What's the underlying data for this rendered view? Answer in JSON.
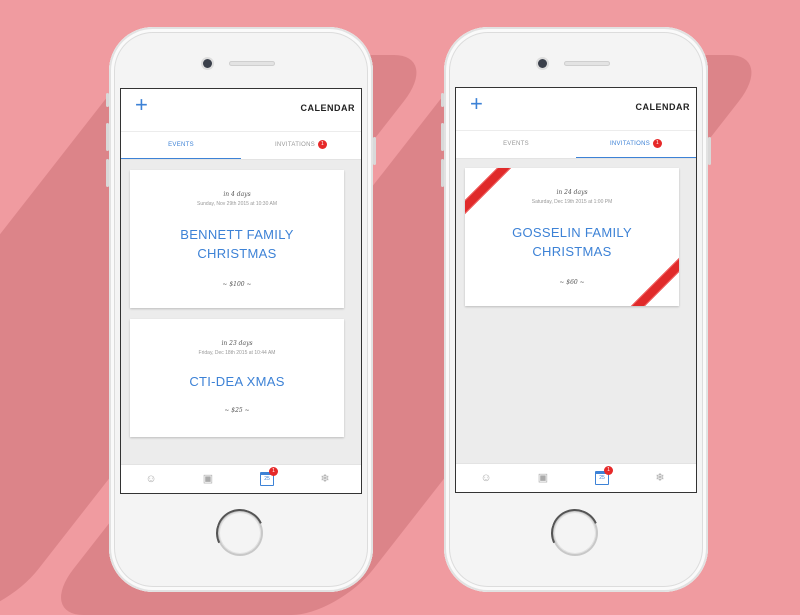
{
  "colors": {
    "background": "#f09ba0",
    "accent": "#3d82d6",
    "badge": "#e62929",
    "ribbon": "#e02a2a"
  },
  "phones": [
    {
      "header": {
        "add_icon": "plus-icon",
        "title": "CALENDAR"
      },
      "tabs": [
        {
          "label": "EVENTS",
          "active": true,
          "badge": ""
        },
        {
          "label": "INVITATIONS",
          "active": false,
          "badge": "1"
        }
      ],
      "cards": [
        {
          "when": "in 4 days",
          "date": "Sunday, Nov 29th 2015 at 10:30 AM",
          "name": "BENNETT FAMILY CHRISTMAS",
          "price": "~ $100 ~"
        },
        {
          "when": "in 23 days",
          "date": "Friday, Dec 18th 2015 at 10:44 AM",
          "name": "CTI-DEA XMAS",
          "price": "~ $25 ~"
        }
      ],
      "nav": {
        "icons": [
          "santa-icon",
          "gift-icon",
          "calendar-icon",
          "snowflake-icon"
        ],
        "active": "calendar-icon",
        "calendar_badge": "1",
        "calendar_glyph": "25"
      }
    },
    {
      "header": {
        "add_icon": "plus-icon",
        "title": "CALENDAR"
      },
      "tabs": [
        {
          "label": "EVENTS",
          "active": false,
          "badge": ""
        },
        {
          "label": "INVITATIONS",
          "active": true,
          "badge": "1"
        }
      ],
      "cards": [
        {
          "when": "in 24 days",
          "date": "Saturday, Dec 19th 2015 at 1:00 PM",
          "name": "GOSSELIN FAMILY CHRISTMAS",
          "price": "~ $60 ~"
        }
      ],
      "nav": {
        "icons": [
          "santa-icon",
          "gift-icon",
          "calendar-icon",
          "snowflake-icon"
        ],
        "active": "calendar-icon",
        "calendar_badge": "1",
        "calendar_glyph": "25"
      }
    }
  ]
}
